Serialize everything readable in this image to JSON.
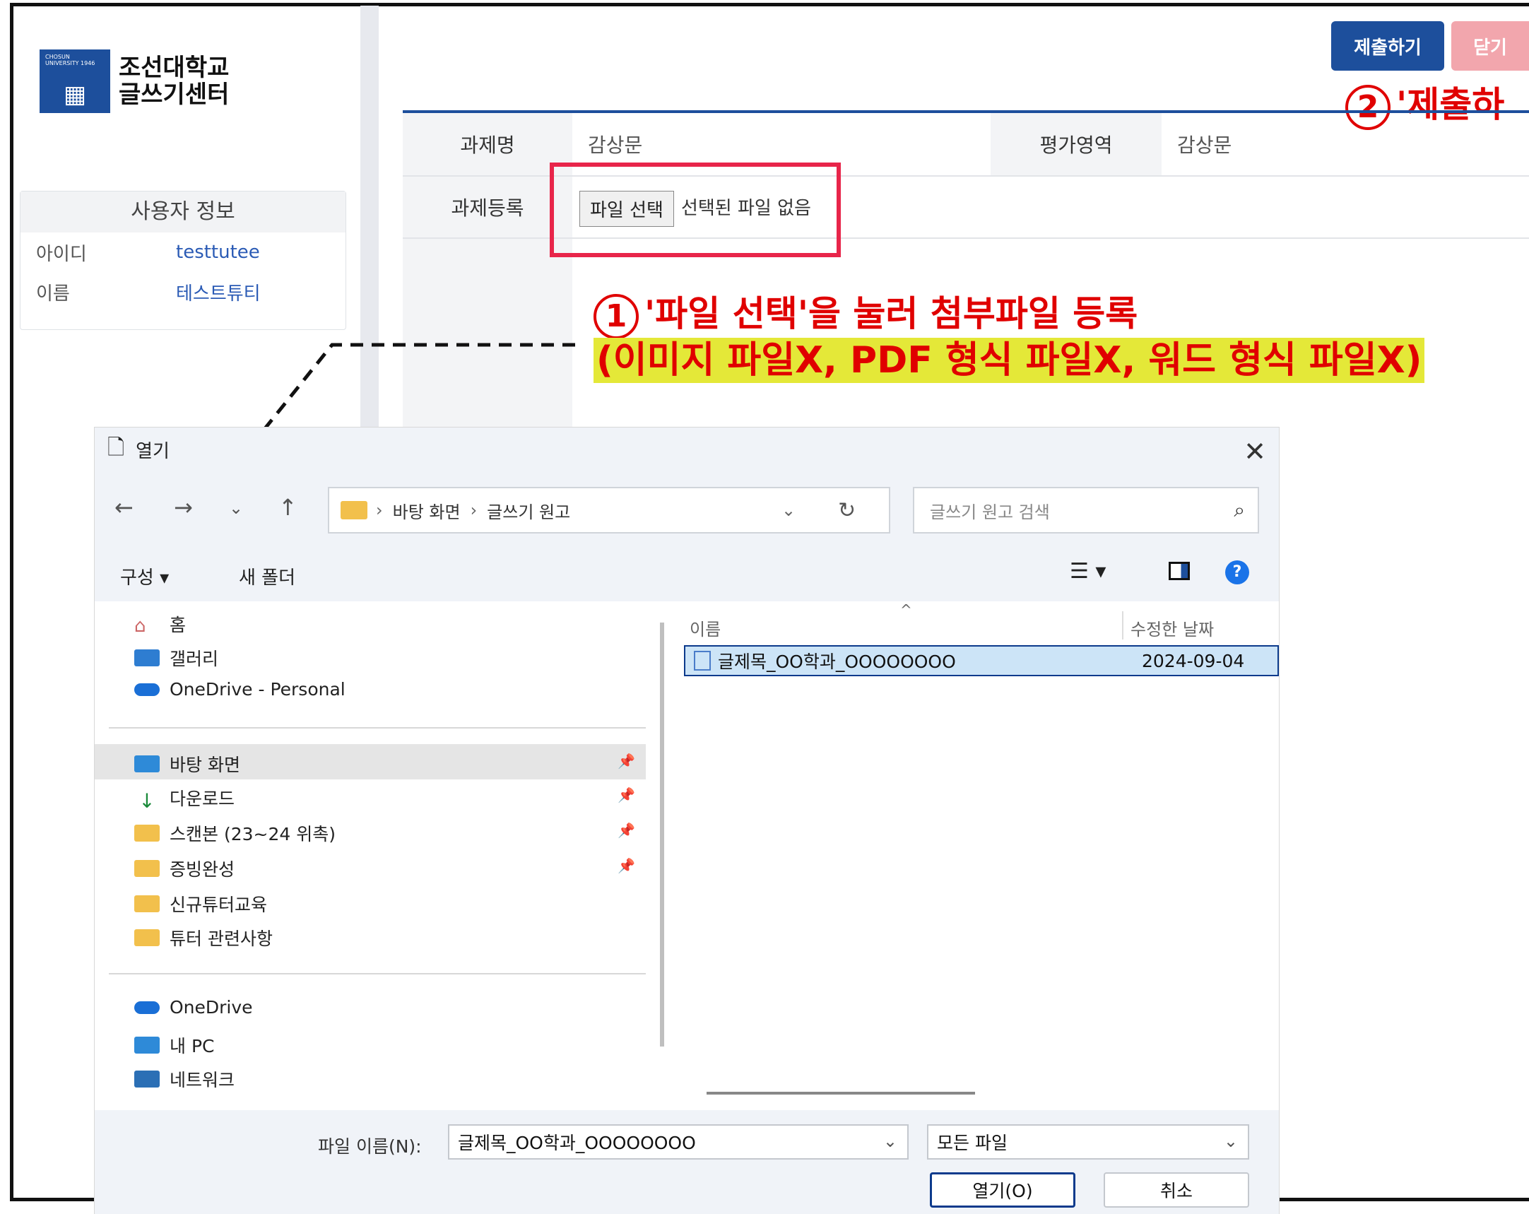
{
  "logo": {
    "small_text": "CHOSUN UNIVERSITY 1946",
    "line1": "조선대학교",
    "line2": "글쓰기센터"
  },
  "user_info": {
    "title": "사용자 정보",
    "rows": [
      {
        "label": "아이디",
        "value": "testtutee"
      },
      {
        "label": "이름",
        "value": "테스트튜티"
      }
    ]
  },
  "actions": {
    "submit": "제출하기",
    "close": "닫기"
  },
  "form": {
    "task_name_label": "과제명",
    "task_name_value": "감상문",
    "eval_area_label": "평가영역",
    "eval_area_value": "감상문",
    "register_label": "과제등록",
    "file_button": "파일 선택",
    "file_status": "선택된 파일 없음"
  },
  "annotations": {
    "step1_num": "1",
    "step1_text": "'파일 선택'을 눌러 첨부파일 등록",
    "step1_sub": "(이미지 파일X, PDF 형식 파일X, 워드 형식 파일X)",
    "step2_num": "2",
    "step2_text": "'제출하"
  },
  "dialog": {
    "title": "열기",
    "breadcrumb": [
      "바탕 화면",
      "글쓰기 원고"
    ],
    "search_placeholder": "글쓰기 원고 검색",
    "organize": "구성 ▾",
    "new_folder": "새 폴더",
    "nav_top": [
      "홈",
      "갤러리",
      "OneDrive - Personal"
    ],
    "nav_quick": [
      "바탕 화면",
      "다운로드",
      "스캔본 (23~24 위촉)",
      "증빙완성",
      "신규튜터교육",
      "튜터 관련사항"
    ],
    "nav_bottom": [
      "OneDrive",
      "내 PC",
      "네트워크"
    ],
    "col_name": "이름",
    "col_modified": "수정한 날짜",
    "files": [
      {
        "name": "글제목_OO학과_OOOOOOOO",
        "modified": "2024-09-04"
      }
    ],
    "filename_label": "파일 이름(N):",
    "filename_value": "글제목_OO학과_OOOOOOOO",
    "filetype": "모든 파일",
    "open": "열기(O)",
    "cancel": "취소"
  },
  "colors": {
    "brand_blue": "#1d4f9c",
    "annotation_red": "#e00000",
    "highlight_yellow": "#e4e838",
    "box_red": "#e8254a"
  }
}
